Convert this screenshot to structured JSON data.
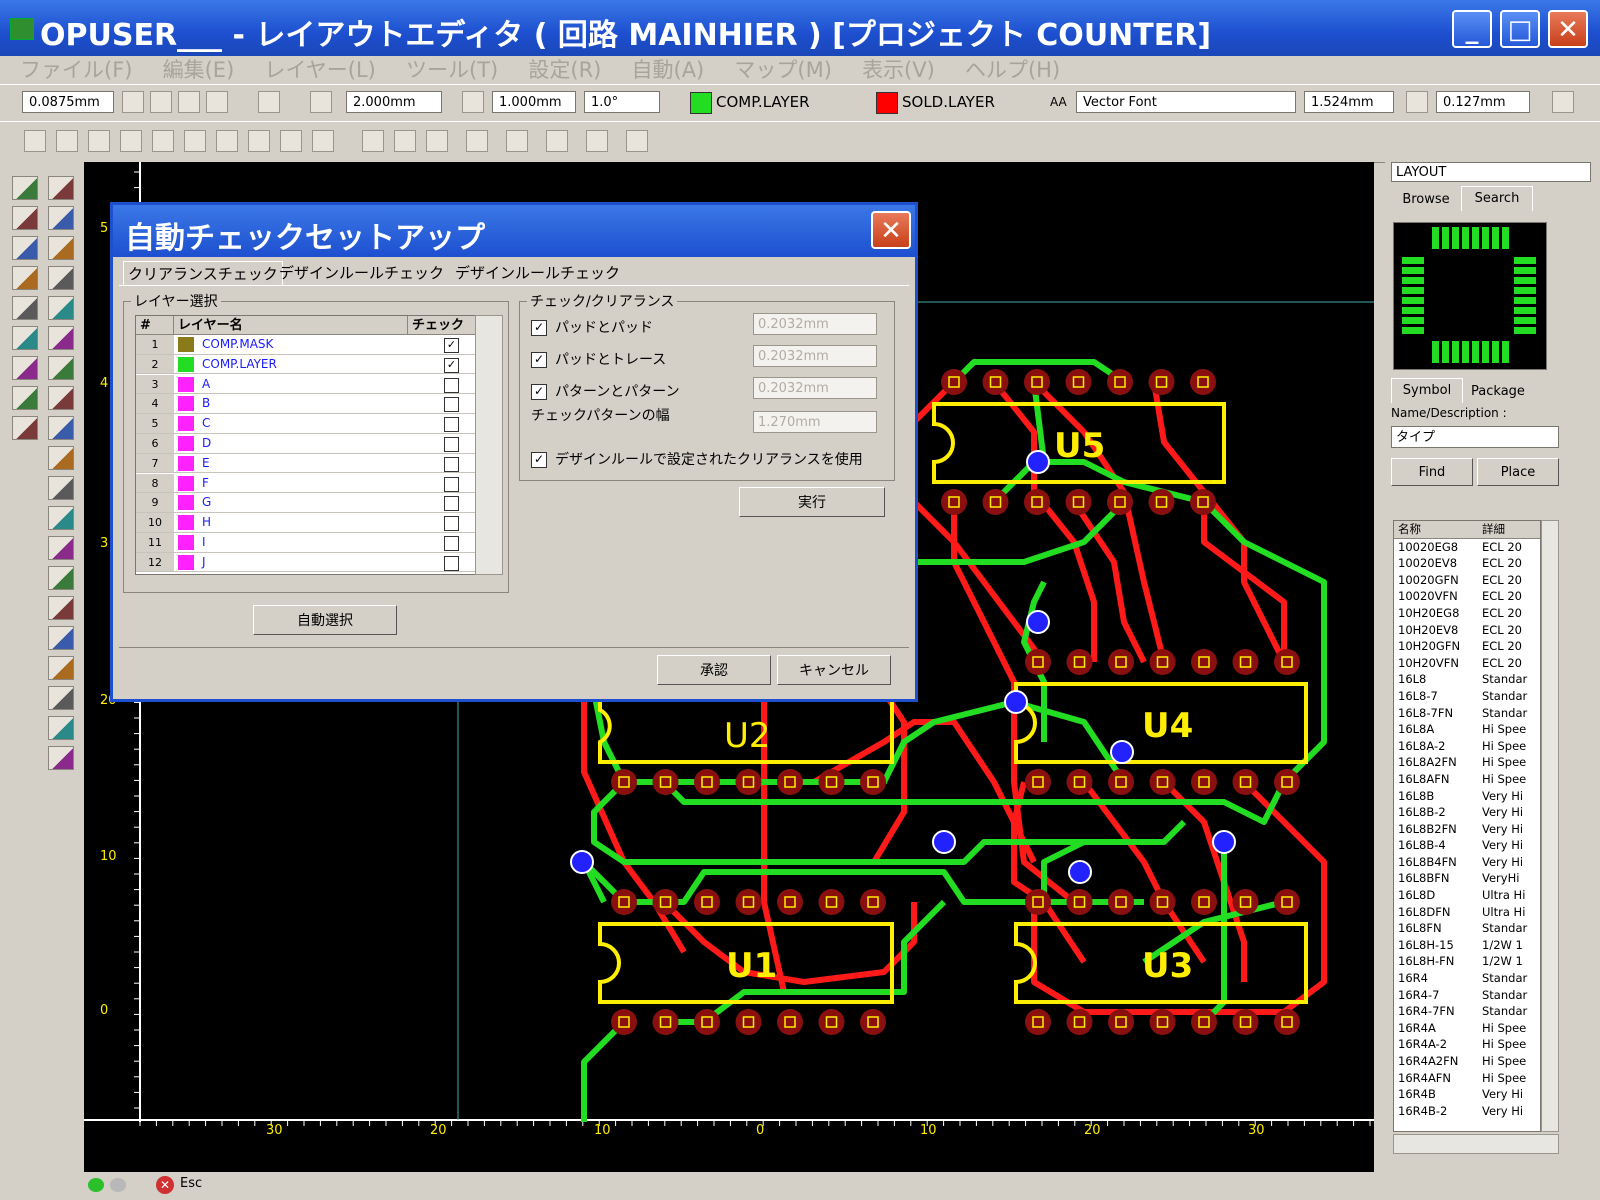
{
  "window": {
    "title": "OPUSER___ - レイアウトエディタ ( 回路 MAINHIER ) [プロジェクト COUNTER]"
  },
  "menu": [
    "ファイル(F)",
    "編集(E)",
    "レイヤー(L)",
    "ツール(T)",
    "設定(R)",
    "自動(A)",
    "マップ(M)",
    "表示(V)",
    "ヘルプ(H)"
  ],
  "toolbar": {
    "zoom_value": "0.0875mm",
    "grid_value": "2.000mm",
    "snap_value": "1.000mm",
    "angle_value": "1.0°",
    "comp_layer": "COMP.LAYER",
    "sold_layer": "SOLD.LAYER",
    "font_prefix": "AA",
    "font_name": "Vector Font",
    "text_size": "1.524mm",
    "line_width": "0.127mm"
  },
  "colors": {
    "comp": "#22dd22",
    "sold": "#ff0000",
    "outline": "#ffee00",
    "via": "#2222ff"
  },
  "canvas": {
    "components": [
      "U5",
      "U4",
      "U2",
      "U1",
      "U3"
    ],
    "y_ticks": [
      "5",
      "4",
      "3",
      "20",
      "10",
      "0"
    ],
    "x_ticks": [
      "30",
      "20",
      "10",
      "0",
      "10",
      "20",
      "30"
    ]
  },
  "right_panel": {
    "view_select": "LAYOUT",
    "tabs_top": [
      "Browse",
      "Search"
    ],
    "tabs_bottom": [
      "Symbol",
      "Package"
    ],
    "name_label": "Name/Description :",
    "type_value": "タイプ",
    "find_label": "Find",
    "place_label": "Place",
    "list_headers": [
      "名称",
      "詳細"
    ],
    "parts": [
      {
        "n": "10020EG8",
        "d": "ECL 20"
      },
      {
        "n": "10020EV8",
        "d": "ECL 20"
      },
      {
        "n": "10020GFN",
        "d": "ECL 20"
      },
      {
        "n": "10020VFN",
        "d": "ECL 20"
      },
      {
        "n": "10H20EG8",
        "d": "ECL 20"
      },
      {
        "n": "10H20EV8",
        "d": "ECL 20"
      },
      {
        "n": "10H20GFN",
        "d": "ECL 20"
      },
      {
        "n": "10H20VFN",
        "d": "ECL 20"
      },
      {
        "n": "16L8",
        "d": "Standar"
      },
      {
        "n": "16L8-7",
        "d": "Standar"
      },
      {
        "n": "16L8-7FN",
        "d": "Standar"
      },
      {
        "n": "16L8A",
        "d": "Hi Spee"
      },
      {
        "n": "16L8A-2",
        "d": "Hi Spee"
      },
      {
        "n": "16L8A2FN",
        "d": "Hi Spee"
      },
      {
        "n": "16L8AFN",
        "d": "Hi Spee"
      },
      {
        "n": "16L8B",
        "d": "Very Hi"
      },
      {
        "n": "16L8B-2",
        "d": "Very Hi"
      },
      {
        "n": "16L8B2FN",
        "d": "Very Hi"
      },
      {
        "n": "16L8B-4",
        "d": "Very Hi"
      },
      {
        "n": "16L8B4FN",
        "d": "Very Hi"
      },
      {
        "n": "16L8BFN",
        "d": "VeryHi"
      },
      {
        "n": "16L8D",
        "d": "Ultra Hi"
      },
      {
        "n": "16L8DFN",
        "d": "Ultra Hi"
      },
      {
        "n": "16L8FN",
        "d": "Standar"
      },
      {
        "n": "16L8H-15",
        "d": "1/2W 1"
      },
      {
        "n": "16L8H-FN",
        "d": "1/2W 1"
      },
      {
        "n": "16R4",
        "d": "Standar"
      },
      {
        "n": "16R4-7",
        "d": "Standar"
      },
      {
        "n": "16R4-7FN",
        "d": "Standar"
      },
      {
        "n": "16R4A",
        "d": "Hi Spee"
      },
      {
        "n": "16R4A-2",
        "d": "Hi Spee"
      },
      {
        "n": "16R4A2FN",
        "d": "Hi Spee"
      },
      {
        "n": "16R4AFN",
        "d": "Hi Spee"
      },
      {
        "n": "16R4B",
        "d": "Very Hi"
      },
      {
        "n": "16R4B-2",
        "d": "Very Hi"
      }
    ]
  },
  "status": {
    "esc_label": "Esc"
  },
  "dialog": {
    "title": "自動チェックセットアップ",
    "tabs": [
      "クリアランスチェック",
      "デザインルールチェック",
      "デザインルールチェック"
    ],
    "layer_group": "レイヤー選択",
    "table_headers": [
      "#",
      "レイヤー名",
      "チェック"
    ],
    "layers": [
      {
        "num": "1",
        "name": "COMP.MASK",
        "color": "#8a7a1a",
        "checked": true
      },
      {
        "num": "2",
        "name": "COMP.LAYER",
        "color": "#22dd22",
        "checked": true
      },
      {
        "num": "3",
        "name": "A",
        "color": "#ff22ff",
        "checked": false
      },
      {
        "num": "4",
        "name": "B",
        "color": "#ff22ff",
        "checked": false
      },
      {
        "num": "5",
        "name": "C",
        "color": "#ff22ff",
        "checked": false
      },
      {
        "num": "6",
        "name": "D",
        "color": "#ff22ff",
        "checked": false
      },
      {
        "num": "7",
        "name": "E",
        "color": "#ff22ff",
        "checked": false
      },
      {
        "num": "8",
        "name": "F",
        "color": "#ff22ff",
        "checked": false
      },
      {
        "num": "9",
        "name": "G",
        "color": "#ff22ff",
        "checked": false
      },
      {
        "num": "10",
        "name": "H",
        "color": "#ff22ff",
        "checked": false
      },
      {
        "num": "11",
        "name": "I",
        "color": "#ff22ff",
        "checked": false
      },
      {
        "num": "12",
        "name": "J",
        "color": "#ff22ff",
        "checked": false
      }
    ],
    "auto_select": "自動選択",
    "check_group": "チェック/クリアランス",
    "checks": [
      {
        "label": "パッドとパッド",
        "value": "0.2032mm"
      },
      {
        "label": "パッドとトレース",
        "value": "0.2032mm"
      },
      {
        "label": "パターンとパターン",
        "value": "0.2032mm"
      }
    ],
    "pattern_width_label": "チェックパターンの幅",
    "pattern_width_value": "1.270mm",
    "use_rule": "デザインルールで設定されたクリアランスを使用",
    "run": "実行",
    "ok": "承認",
    "cancel": "キャンセル"
  }
}
